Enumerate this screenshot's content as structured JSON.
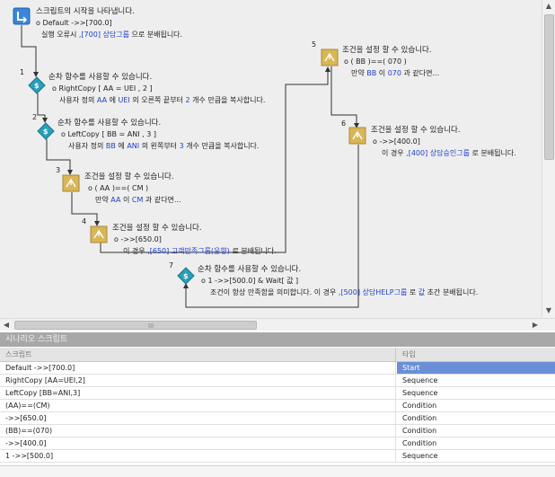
{
  "diagram": {
    "start": {
      "title": "스크립트의 시작을 나타냅니다.",
      "line1": "o Default ->>[700.0]",
      "line2_a": "실행 오류시 ",
      "line2_link": ",[700] 상담그룹",
      "line2_b": " 으로 분배됩니다."
    },
    "nodes": [
      {
        "num": "1",
        "title": "순차 함수를 사용할 수 있습니다.",
        "line1": "o RightCopy [ AA = UEI , 2 ]",
        "line2_a": "사용자 정의 ",
        "line2_v1": "AA",
        "line2_b": " 에 ",
        "line2_v2": "UEI",
        "line2_c": " 의 오른쪽 끝부터 ",
        "line2_v3": "2",
        "line2_d": " 개수 만큼을 복사합니다."
      },
      {
        "num": "2",
        "title": "순차 함수를 사용할 수 있습니다.",
        "line1": "o LeftCopy [ BB = ANI , 3 ]",
        "line2_a": "사용자 정의 ",
        "line2_v1": "BB",
        "line2_b": " 에 ",
        "line2_v2": "ANI",
        "line2_c": " 의 왼쪽부터 ",
        "line2_v3": "3",
        "line2_d": " 개수 만큼을 복사합니다."
      },
      {
        "num": "3",
        "title": "조건을 설정 할 수 있습니다.",
        "line1": "o ( AA )==( CM )",
        "line2_a": "만약 ",
        "line2_v1": "AA",
        "line2_b": " 이 ",
        "line2_v2": "CM",
        "line2_c": " 과 같다면..."
      },
      {
        "num": "4",
        "title": "조건을 설정 할 수 있습니다.",
        "line1": "o ->>[650.0]",
        "line2_a": "이 경우 ",
        "line2_link": ",[650] 고객만족그룹(응향)",
        "line2_b": " 로 분배됩니다."
      },
      {
        "num": "5",
        "title": "조건을 설정 할 수 있습니다.",
        "line1": "o ( BB )==( 070 )",
        "line2_a": "만약 ",
        "line2_v1": "BB",
        "line2_b": " 이 ",
        "line2_v2": "070",
        "line2_c": " 과 같다면..."
      },
      {
        "num": "6",
        "title": "조건을 설정 할 수 있습니다.",
        "line1": "o ->>[400.0]",
        "line2_a": "이 경우 ",
        "line2_link": ",[400] 상담승인그룹",
        "line2_b": " 로 분배됩니다."
      },
      {
        "num": "7",
        "title": "순차 함수를 사용할 수 있습니다.",
        "line1": "o 1 ->>[500.0]  & Wait[  값  ]",
        "line2_a": "조건이 항상 만족함을 의미합니다. 이 경우 ",
        "line2_link": ",[500] 상담HELP그룹",
        "line2_b": " 로 ",
        "line2_v1": "값",
        "line2_c": " 초간 분배됩니다."
      }
    ]
  },
  "hscroll": {
    "grip": "III"
  },
  "panel": {
    "title": "시나리오 스크립트"
  },
  "table": {
    "columns": [
      "스크립트",
      "타입"
    ],
    "rows": [
      {
        "script": "Default ->>[700.0]",
        "type": "Start",
        "selected": true
      },
      {
        "script": "RightCopy [AA=UEI,2]",
        "type": "Sequence",
        "selected": false
      },
      {
        "script": "LeftCopy [BB=ANI,3]",
        "type": "Sequence",
        "selected": false
      },
      {
        "script": "(AA)==(CM)",
        "type": "Condition",
        "selected": false
      },
      {
        "script": "->>[650.0]",
        "type": "Condition",
        "selected": false
      },
      {
        "script": "(BB)==(070)",
        "type": "Condition",
        "selected": false
      },
      {
        "script": "->>[400.0]",
        "type": "Condition",
        "selected": false
      },
      {
        "script": "1 ->>[500.0]",
        "type": "Sequence",
        "selected": false
      }
    ]
  },
  "colors": {
    "link": "#1d3fd0",
    "selected_row": "#6b8fd6",
    "start_icon": "#3a86d8",
    "condition_icon": "#d9b656",
    "sequence_icon": "#2aa0b8"
  },
  "icons": [
    "start-icon",
    "sequence-icon",
    "condition-icon",
    "arrow-up-icon",
    "arrow-down-icon",
    "arrow-left-icon",
    "arrow-right-icon"
  ]
}
